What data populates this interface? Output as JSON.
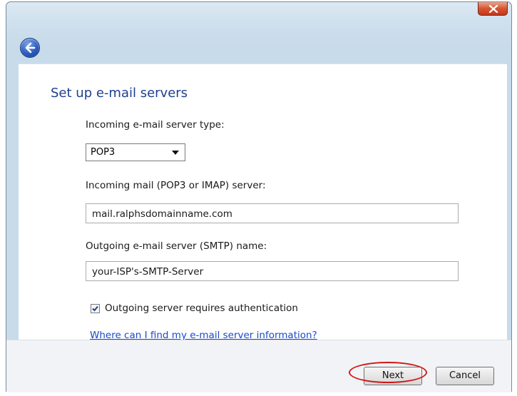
{
  "window": {
    "page_title": "Set up e-mail servers"
  },
  "form": {
    "incoming_type_label": "Incoming e-mail server type:",
    "incoming_type_value": "POP3",
    "incoming_server_label": "Incoming mail (POP3 or IMAP) server:",
    "incoming_server_value": "mail.ralphsdomainname.com",
    "outgoing_server_label": "Outgoing e-mail server (SMTP) name:",
    "outgoing_server_value": "your-ISP's-SMTP-Server",
    "auth_checkbox_label": "Outgoing server requires authentication",
    "auth_checkbox_checked": true,
    "help_link": "Where can I find my e-mail server information?"
  },
  "footer": {
    "next_label": "Next",
    "cancel_label": "Cancel"
  },
  "icons": {
    "close": "close-icon",
    "back": "back-arrow-icon",
    "dropdown": "chevron-down-icon",
    "check": "checkmark-icon"
  },
  "colors": {
    "title": "#1e3f8f",
    "link": "#1a49c7",
    "close_button": "#d7542f",
    "highlight": "#d01818"
  }
}
